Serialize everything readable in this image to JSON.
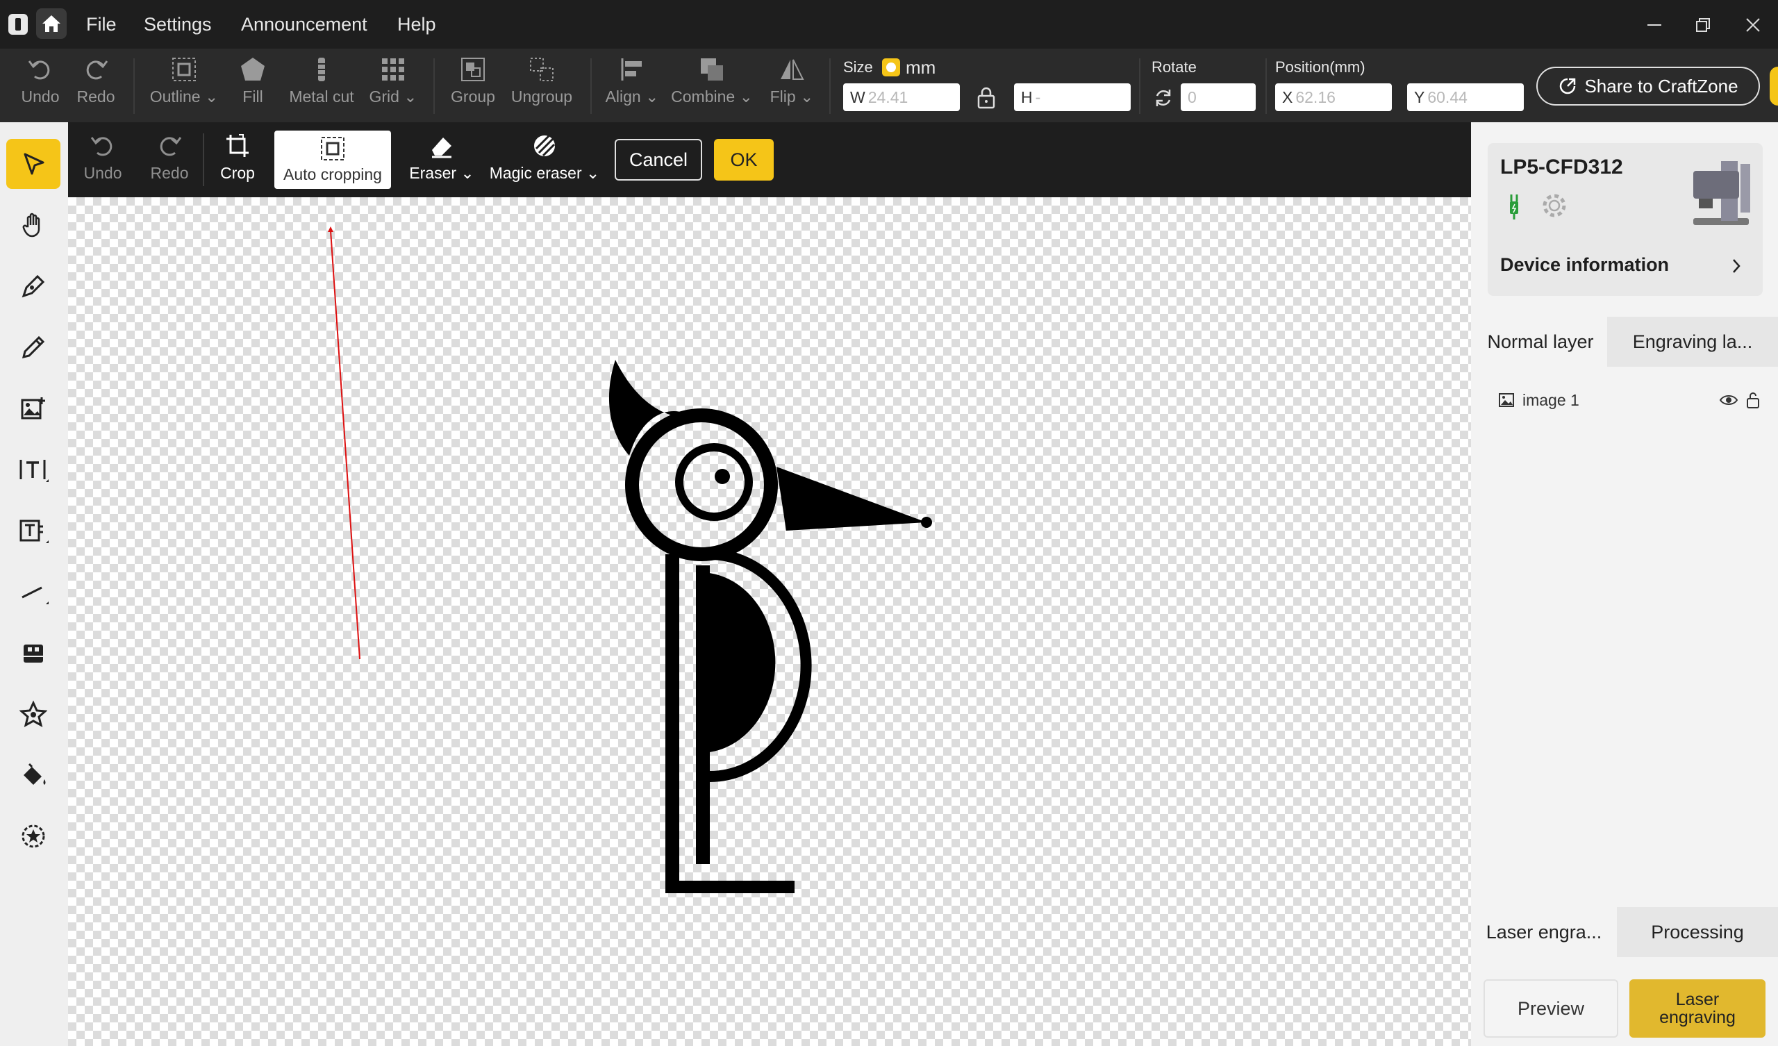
{
  "menu": {
    "file": "File",
    "settings": "Settings",
    "announcement": "Announcement",
    "help": "Help"
  },
  "toolbar": {
    "undo": "Undo",
    "redo": "Redo",
    "outline": "Outline",
    "fill": "Fill",
    "metal_cut": "Metal cut",
    "grid": "Grid",
    "group": "Group",
    "ungroup": "Ungroup",
    "align": "Align",
    "combine": "Combine",
    "flip": "Flip",
    "size_label": "Size",
    "unit": "mm",
    "w_prefix": "W",
    "w_value": "24.41",
    "h_prefix": "H",
    "h_value": "-",
    "rotate_label": "Rotate",
    "rotate_value": "0",
    "position_label": "Position(mm)",
    "x_prefix": "X",
    "x_value": "62.16",
    "y_prefix": "Y",
    "y_value": "60.44",
    "share": "Share to CraftZone"
  },
  "editbar": {
    "undo": "Undo",
    "redo": "Redo",
    "crop": "Crop",
    "auto_cropping": "Auto cropping",
    "eraser": "Eraser",
    "magic_eraser": "Magic eraser",
    "cancel": "Cancel",
    "ok": "OK"
  },
  "device": {
    "name": "LP5-CFD312",
    "info_label": "Device information"
  },
  "layers": {
    "tab_normal": "Normal layer",
    "tab_engraving": "Engraving la...",
    "items": [
      {
        "name": "image 1"
      }
    ]
  },
  "bottom_tabs": {
    "laser": "Laser engra...",
    "processing": "Processing"
  },
  "actions": {
    "preview": "Preview",
    "laser_engraving": "Laser engraving"
  },
  "colors": {
    "accent": "#f5c518",
    "toolbar_bg": "#2b2b2b",
    "titlebar_bg": "#1e1e1e"
  }
}
